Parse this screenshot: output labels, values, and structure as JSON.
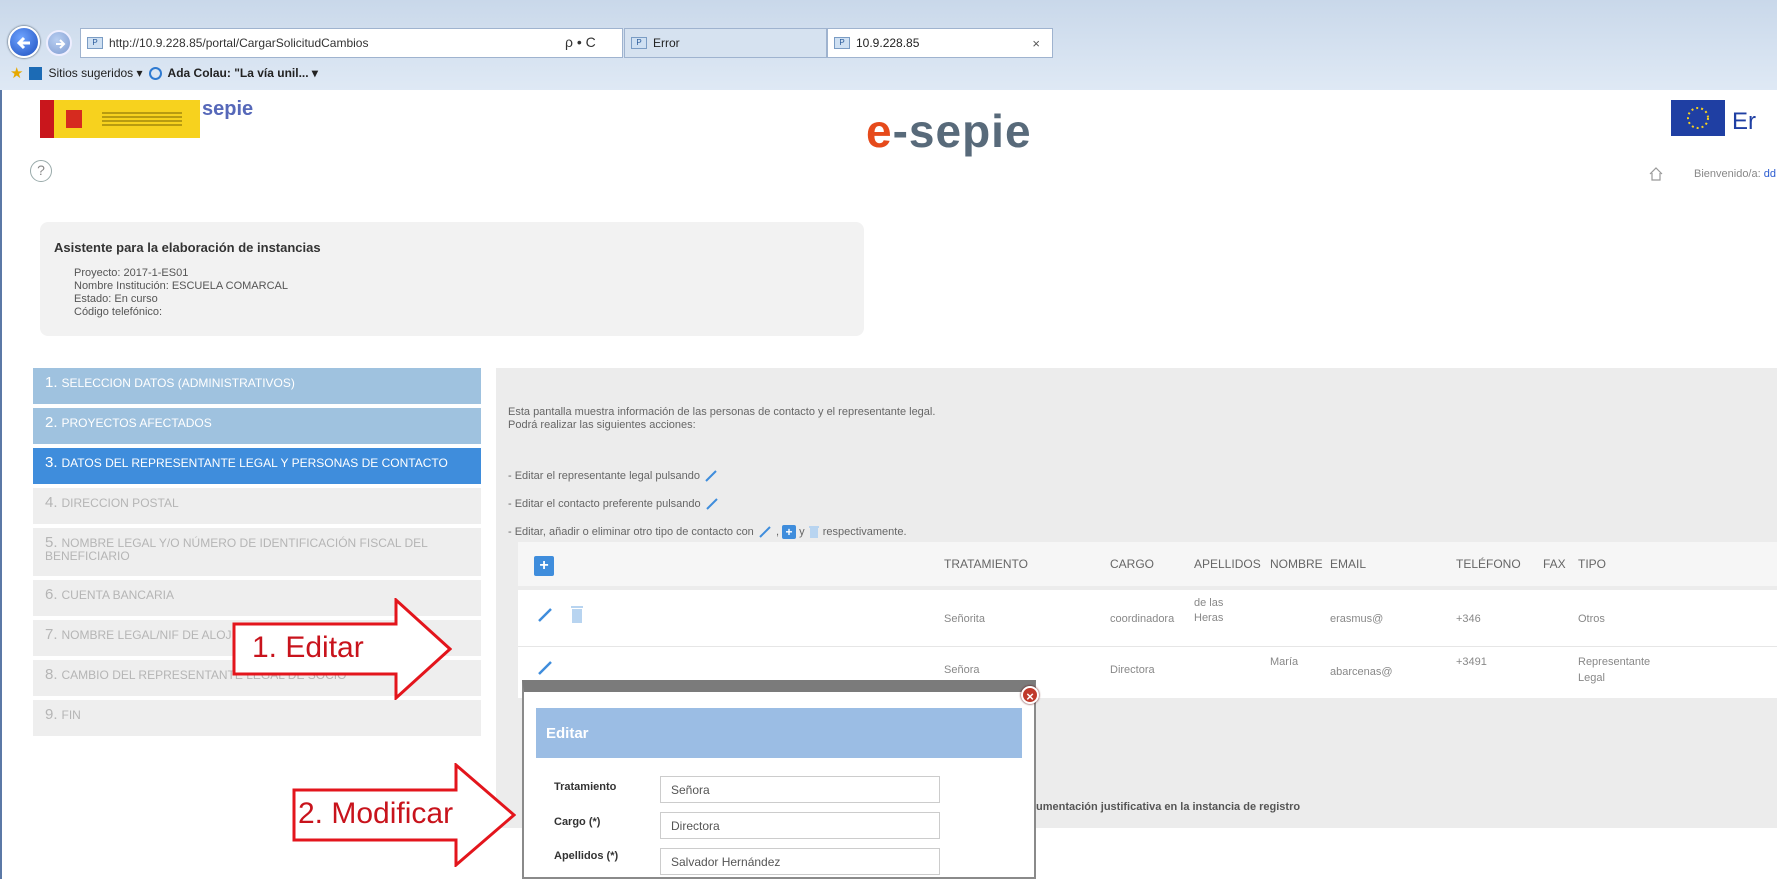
{
  "browser": {
    "url": "http://10.9.228.85/portal/CargarSolicitudCambios",
    "url_bold": "10.9.228.85",
    "search_controls": "ρ • С",
    "tab1_label": "Error",
    "tab2_label": "10.9.228.85",
    "tab_close": "×",
    "fav_suggested": "Sitios sugeridos ▾",
    "fav_link": "Ada Colau: \"La vía unil... ▾"
  },
  "header": {
    "gov_logo_text": "sepie",
    "brand_prefix": "e",
    "brand_suffix": "-sepie",
    "eu_text": "Er",
    "help": "?",
    "welcome_label": "Bienvenido/a:",
    "welcome_user": "dd"
  },
  "info": {
    "title": "Asistente para la elaboración de instancias",
    "proyecto": "Proyecto: 2017-1-ES01",
    "institucion": "Nombre Institución: ESCUELA COMARCAL",
    "estado": "Estado:  En curso",
    "codigo": "Código telefónico:"
  },
  "steps": [
    {
      "num": "1.",
      "label": "SELECCION DATOS (ADMINISTRATIVOS)"
    },
    {
      "num": "2.",
      "label": "PROYECTOS AFECTADOS"
    },
    {
      "num": "3.",
      "label": "DATOS DEL REPRESENTANTE LEGAL Y PERSONAS DE CONTACTO"
    },
    {
      "num": "4.",
      "label": "DIRECCION POSTAL"
    },
    {
      "num": "5.",
      "label": "NOMBRE LEGAL Y/O NÚMERO DE IDENTIFICACIÓN FISCAL DEL BENEFICIARIO"
    },
    {
      "num": "6.",
      "label": "CUENTA BANCARIA"
    },
    {
      "num": "7.",
      "label": "NOMBRE LEGAL/NIF DE ALOJ..."
    },
    {
      "num": "8.",
      "label": "CAMBIO DEL REPRESENTANTE LEGAL DE SOCIO"
    },
    {
      "num": "9.",
      "label": "FIN"
    }
  ],
  "content": {
    "intro_line1": "Esta pantalla muestra información de las personas de contacto y el representante legal.",
    "intro_line2": "Podrá realizar las siguientes acciones:",
    "action1": "- Editar el representante legal pulsando",
    "action2": "- Editar el contacto preferente pulsando",
    "action3_a": "- Editar, añadir o eliminar otro tipo de contacto con",
    "action3_b": ",",
    "action3_c": "y",
    "action3_d": "respectivamente.",
    "footer": "umentación justificativa en la instancia de registro"
  },
  "table": {
    "add_button": "+",
    "headers": [
      "TRATAMIENTO",
      "CARGO",
      "APELLIDOS",
      "NOMBRE",
      "EMAIL",
      "TELÉFONO",
      "FAX",
      "TIPO"
    ],
    "rows": [
      {
        "tratamiento": "Señorita",
        "cargo": "coordinadora",
        "apellidos_1": "de las",
        "apellidos_2": "Heras",
        "nombre": "",
        "email": "erasmus@",
        "telefono": "+346",
        "fax": "",
        "tipo_1": "Otros",
        "tipo_2": ""
      },
      {
        "tratamiento": "Señora",
        "cargo": "Directora",
        "apellidos_1": "",
        "apellidos_2": "",
        "nombre": "María",
        "email": "abarcenas@",
        "telefono": "+3491",
        "fax": "",
        "tipo_1": "Representante",
        "tipo_2": "Legal"
      }
    ]
  },
  "annotations": {
    "step1": "1. Editar",
    "step2": "2. Modificar",
    "color": "#e3151c"
  },
  "modal": {
    "title": "Editar",
    "close": "×",
    "fields": [
      {
        "label": "Tratamiento",
        "value": "Señora"
      },
      {
        "label": "Cargo (*)",
        "value": "Directora"
      },
      {
        "label": "Apellidos (*)",
        "value": "Salvador Hernández"
      }
    ]
  }
}
